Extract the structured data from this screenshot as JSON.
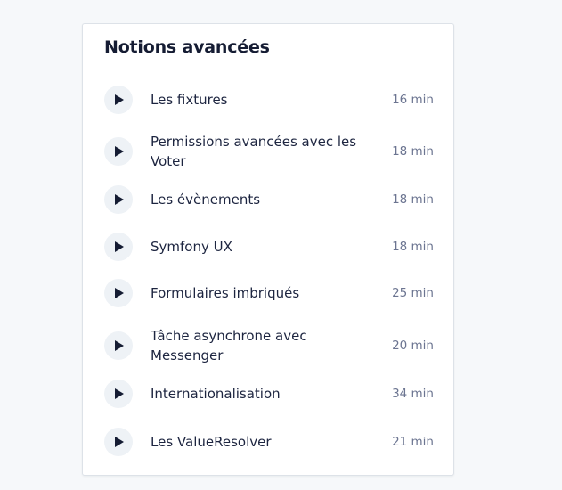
{
  "section": {
    "title": "Notions avancées",
    "lessons": [
      {
        "title": "Les fixtures",
        "duration": "16 min"
      },
      {
        "title": "Permissions avancées avec les Voter",
        "duration": "18 min"
      },
      {
        "title": "Les évènements",
        "duration": "18 min"
      },
      {
        "title": "Symfony UX",
        "duration": "18 min"
      },
      {
        "title": "Formulaires imbriqués",
        "duration": "25 min"
      },
      {
        "title": "Tâche asynchrone avec Messenger",
        "duration": "20 min"
      },
      {
        "title": "Internationalisation",
        "duration": "34 min"
      },
      {
        "title": "Les ValueResolver",
        "duration": "21 min"
      }
    ]
  },
  "icons": {
    "lesson_play": "play-icon"
  },
  "colors": {
    "background": "#f6f8fa",
    "card": "#ffffff",
    "title": "#151c33",
    "text": "#1d2540",
    "muted": "#6c7591",
    "play_circle": "#eef2f6",
    "play_glyph": "#151c33"
  }
}
